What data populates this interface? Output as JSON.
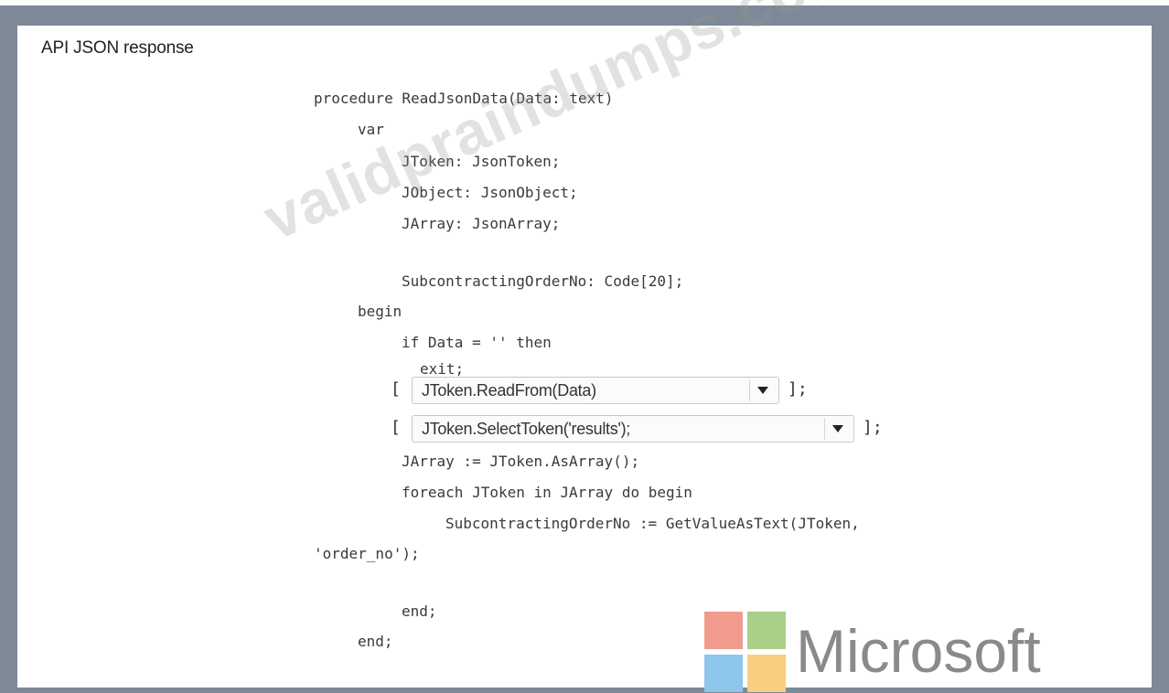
{
  "heading": "API JSON response",
  "code": {
    "l1": "procedure ReadJsonData(Data: text)",
    "l2": "var",
    "l3": "JToken: JsonToken;",
    "l4": "JObject: JsonObject;",
    "l5": "JArray: JsonArray;",
    "l6": "SubcontractingOrderNo: Code[20];",
    "l7": "begin",
    "l8": "if Data = '' then",
    "l9": "exit;",
    "l10": "JArray := JToken.AsArray();",
    "l11": "foreach JToken in JArray do begin",
    "l12": "SubcontractingOrderNo := GetValueAsText(JToken,",
    "l13": "'order_no');",
    "l14": "end;",
    "l15": "end;"
  },
  "dropdowns": {
    "d1": {
      "open": "[",
      "value": "JToken.ReadFrom(Data)",
      "close": "];"
    },
    "d2": {
      "open": "[",
      "value": "JToken.SelectToken('results');",
      "close": "];"
    }
  },
  "watermark": "validpraindumps.com",
  "logo": {
    "text": "Microsoft",
    "colors": [
      "#f19b8e",
      "#a9cf89",
      "#8ec5eb",
      "#f8cf7e"
    ]
  }
}
